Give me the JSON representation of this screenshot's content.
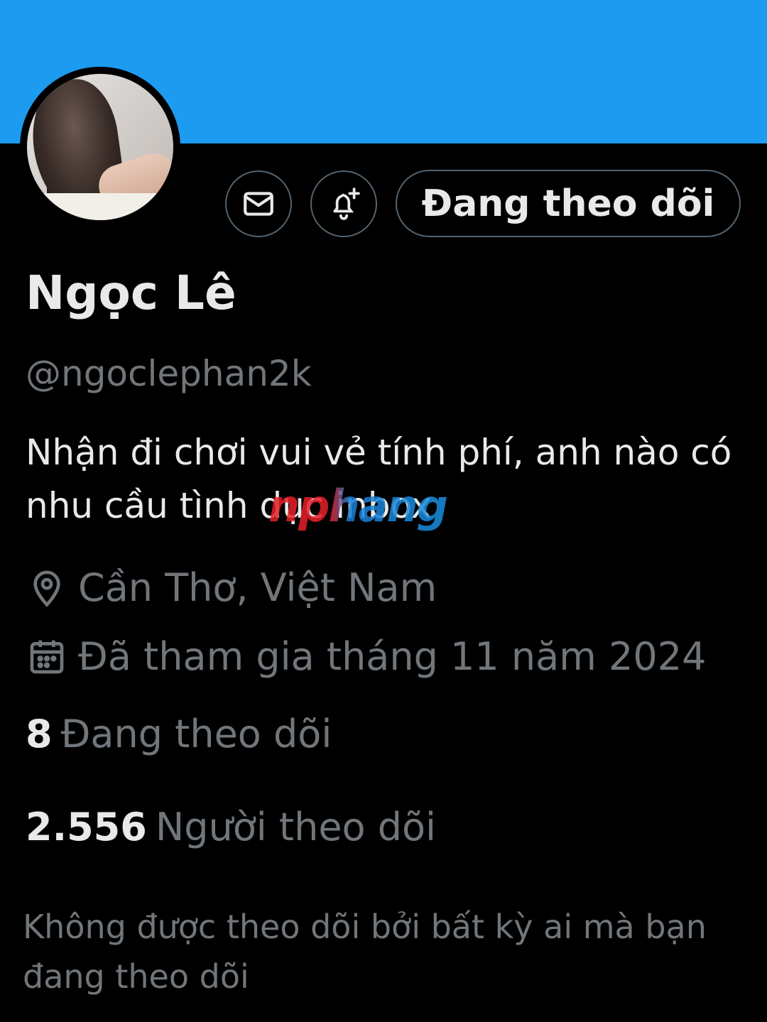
{
  "profile": {
    "name": "Ngọc Lê",
    "handle": "@ngoclephan2k",
    "bio": "Nhận đi chơi vui vẻ tính phí, anh nào có nhu cầu tình dục inbox",
    "location": "Cần Thơ, Việt Nam",
    "joined": "Đã tham gia tháng 11 năm 2024"
  },
  "actions": {
    "follow_label": "Đang theo dõi"
  },
  "stats": {
    "following_count": "8",
    "following_label": "Đang theo dõi",
    "followers_count": "2.556",
    "followers_label": "Người theo dõi"
  },
  "notice": "Không được theo dõi bởi bất kỳ ai mà bạn đang theo dõi",
  "watermark": "nphang",
  "colors": {
    "banner": "#1d9bf0",
    "background": "#000000",
    "primary_text": "#e7e9ea",
    "secondary_text": "#71767b",
    "border": "#536471"
  },
  "icons": {
    "message": "envelope-icon",
    "notify": "bell-plus-icon",
    "location": "map-pin-icon",
    "joined": "calendar-icon"
  }
}
